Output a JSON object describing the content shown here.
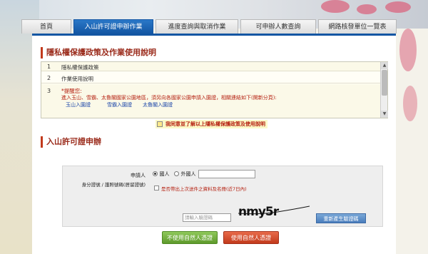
{
  "tabs": [
    {
      "label": "首頁",
      "active": false
    },
    {
      "label": "入山許可證申辦作業",
      "active": true
    },
    {
      "label": "進度查詢與取消作業",
      "active": false
    },
    {
      "label": "可申辦人數查詢",
      "active": false
    },
    {
      "label": "網路核發單位一覽表",
      "active": false
    }
  ],
  "privacy": {
    "title": "隱私權保護政策及作業使用說明",
    "rows": [
      {
        "num": "1",
        "text": "隱私權保護政策"
      },
      {
        "num": "2",
        "text": "作業使用說明"
      },
      {
        "num": "3",
        "notice": "*提醒您:",
        "line1": "進入玉山、雪霸、太魯閣國家公園地區，須另向各國家公園申請入園證，相關連結如下(開新分頁):",
        "links": [
          "玉山入園證",
          "雪霸入園證",
          "太魯閣入園證"
        ]
      }
    ],
    "agree_label": "我同意並了解以上隱私權保護政策及使用說明"
  },
  "application": {
    "title": "入山許可證申辦",
    "applicant_label": "申請人",
    "id_label": "身分證號 / 護照號碼(居留證號)",
    "domestic": "國人",
    "foreign": "外國人",
    "reuse_label": "是否帶出上次送件之資料及名冊(近7日內)",
    "captcha_placeholder": "請輸入驗證碼",
    "captcha_text": "nmy5r",
    "regen_label": "重新產生驗證碼",
    "btn_no_cert": "不使用自然人憑證",
    "btn_cert": "使用自然人憑證"
  },
  "colors": {
    "accent": "#1356a3",
    "title": "#9a2a1a",
    "green": "#5e9a2c",
    "red": "#c23a1c"
  }
}
